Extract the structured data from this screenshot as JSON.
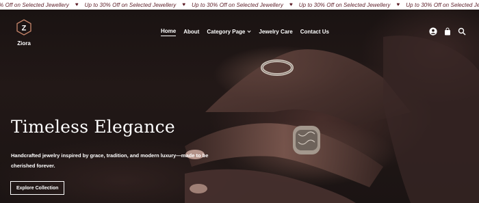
{
  "announcement": {
    "message": "Up to 30% Off on Selected Jewellery",
    "first_fragment": "30% Off on Selected Jewellery",
    "separator_icon": "heart-icon",
    "color": "#5a1a24"
  },
  "brand": {
    "letter": "Z",
    "name": "Ziora"
  },
  "nav": {
    "items": [
      {
        "label": "Home",
        "active": true
      },
      {
        "label": "About"
      },
      {
        "label": "Category Page",
        "has_dropdown": true
      },
      {
        "label": "Jewelry Care"
      },
      {
        "label": "Contact Us"
      }
    ]
  },
  "header_icons": [
    "user-icon",
    "shopping-bag-icon",
    "search-icon"
  ],
  "hero": {
    "title": "Timeless Elegance",
    "subtitle": "Handcrafted jewelry inspired by grace, tradition, and modern luxury—made to be cherished forever.",
    "cta_label": "Explore Collection"
  }
}
